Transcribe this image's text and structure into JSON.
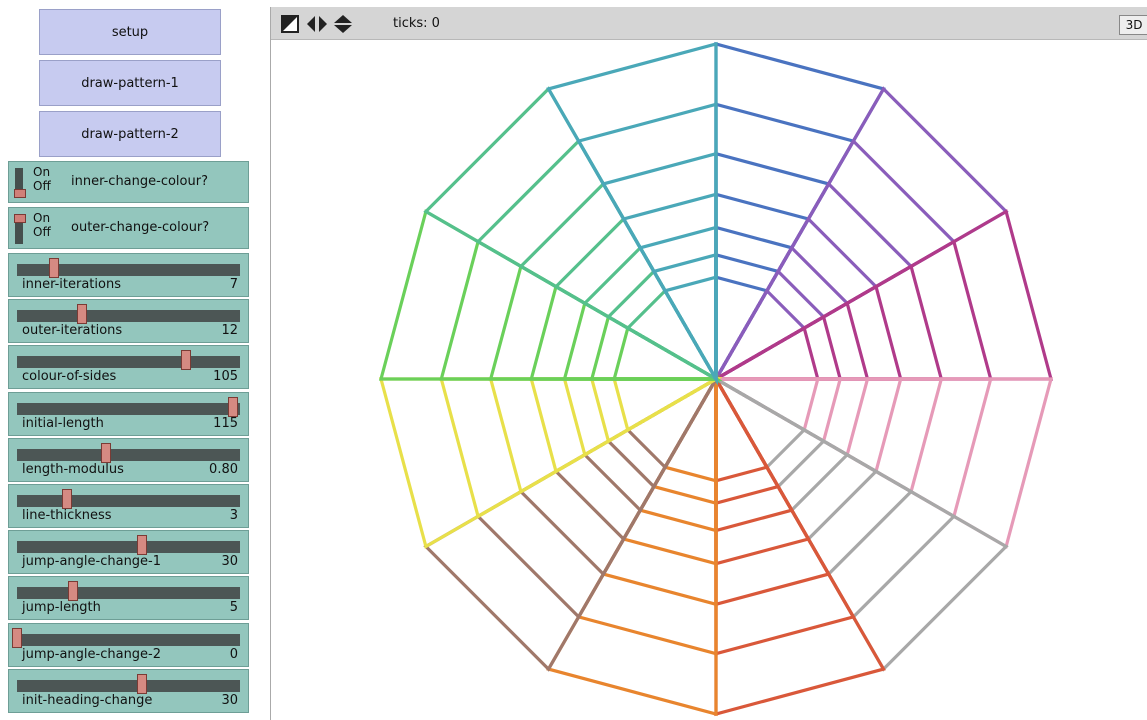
{
  "buttons": [
    {
      "name": "setup-button",
      "label": "setup"
    },
    {
      "name": "draw-pattern-1-button",
      "label": "draw-pattern-1"
    },
    {
      "name": "draw-pattern-2-button",
      "label": "draw-pattern-2"
    }
  ],
  "switches": [
    {
      "name": "inner-change-colour-switch",
      "label": "inner-change-colour?",
      "on_text": "On",
      "off_text": "Off",
      "state": "off"
    },
    {
      "name": "outer-change-colour-switch",
      "label": "outer-change-colour?",
      "on_text": "On",
      "off_text": "Off",
      "state": "on"
    }
  ],
  "sliders": [
    {
      "name": "inner-iterations-slider",
      "label": "inner-iterations",
      "value": "7",
      "fraction": 0.17
    },
    {
      "name": "outer-iterations-slider",
      "label": "outer-iterations",
      "value": "12",
      "fraction": 0.3
    },
    {
      "name": "colour-of-sides-slider",
      "label": "colour-of-sides",
      "value": "105",
      "fraction": 0.78
    },
    {
      "name": "initial-length-slider",
      "label": "initial-length",
      "value": "115",
      "fraction": 1.0
    },
    {
      "name": "length-modulus-slider",
      "label": "length-modulus",
      "value": "0.80",
      "fraction": 0.41
    },
    {
      "name": "line-thickness-slider",
      "label": "line-thickness",
      "value": "3",
      "fraction": 0.23
    },
    {
      "name": "jump-angle-change-1-slider",
      "label": "jump-angle-change-1",
      "value": "30",
      "fraction": 0.58
    },
    {
      "name": "jump-length-slider",
      "label": "jump-length",
      "value": "5",
      "fraction": 0.26
    },
    {
      "name": "jump-angle-change-2-slider",
      "label": "jump-angle-change-2",
      "value": "0",
      "fraction": 0.0
    },
    {
      "name": "init-heading-change-slider",
      "label": "init-heading-change",
      "value": "30",
      "fraction": 0.58
    }
  ],
  "view": {
    "ticks_text": "ticks: 0",
    "three_d_label": "3D",
    "colors": [
      "#4a73c0",
      "#8a5dbb",
      "#b03a8a",
      "#e69ab8",
      "#a8a8a8",
      "#d9583a",
      "#e8852e",
      "#a0786a",
      "#e8e04a",
      "#6ad05a",
      "#55c08c",
      "#4aa8b8"
    ],
    "inner_iterations": 7,
    "outer_iterations": 12,
    "initial_length": 115,
    "length_modulus": 0.8
  }
}
